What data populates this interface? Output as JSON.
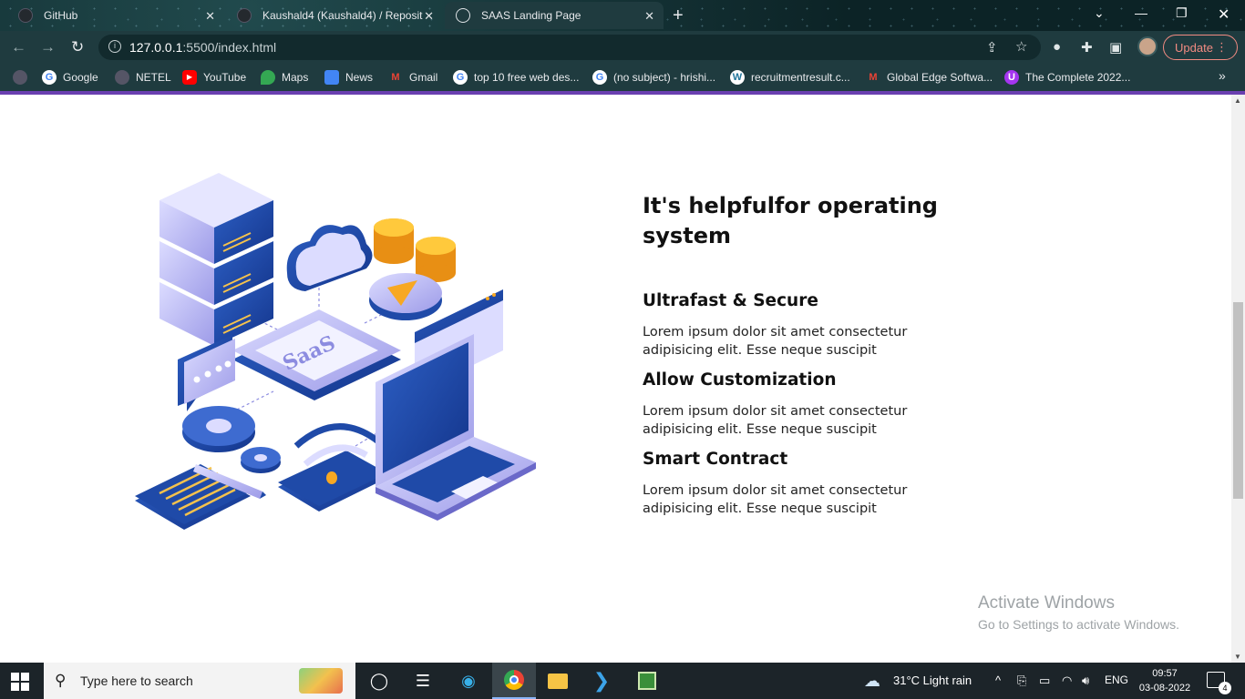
{
  "browser": {
    "tabs": [
      {
        "title": "GitHub",
        "active": false
      },
      {
        "title": "Kaushald4 (Kaushald4) / Reposit",
        "active": false
      },
      {
        "title": "SAAS Landing Page",
        "active": true
      }
    ],
    "url_host": "127.0.0.1",
    "url_path": ":5500/index.html",
    "update_label": "Update",
    "bookmarks": [
      {
        "label": "Google",
        "icon": "google-icon"
      },
      {
        "label": "NETEL",
        "icon": "globe-icon"
      },
      {
        "label": "YouTube",
        "icon": "youtube-icon"
      },
      {
        "label": "Maps",
        "icon": "maps-icon"
      },
      {
        "label": "News",
        "icon": "news-icon"
      },
      {
        "label": "Gmail",
        "icon": "gmail-icon"
      },
      {
        "label": "top 10 free web des...",
        "icon": "google-icon"
      },
      {
        "label": "(no subject) - hrishi...",
        "icon": "google-icon"
      },
      {
        "label": "recruitmentresult.c...",
        "icon": "wordpress-icon"
      },
      {
        "label": "Global Edge Softwa...",
        "icon": "gmail-icon"
      },
      {
        "label": "The Complete 2022...",
        "icon": "udemy-icon"
      }
    ]
  },
  "page": {
    "illustration_label": "SaaS",
    "heading": "It's helpfulfor operating system",
    "features": [
      {
        "title": "Ultrafast & Secure",
        "text": "Lorem ipsum dolor sit amet consectetur adipisicing elit. Esse neque suscipit"
      },
      {
        "title": "Allow Customization",
        "text": "Lorem ipsum dolor sit amet consectetur adipisicing elit. Esse neque suscipit"
      },
      {
        "title": "Smart Contract",
        "text": "Lorem ipsum dolor sit amet consectetur adipisicing elit. Esse neque suscipit"
      }
    ]
  },
  "watermark": {
    "line1": "Activate Windows",
    "line2": "Go to Settings to activate Windows."
  },
  "taskbar": {
    "search_placeholder": "Type here to search",
    "weather": "31°C  Light rain",
    "language": "ENG",
    "time": "09:57",
    "date": "03-08-2022",
    "notifications": "4"
  },
  "colors": {
    "accent_purple": "#6a3fb0",
    "illustration_blue": "#1f4aa8",
    "illustration_lilac": "#b8b7f2",
    "coin_orange": "#f7a823"
  }
}
